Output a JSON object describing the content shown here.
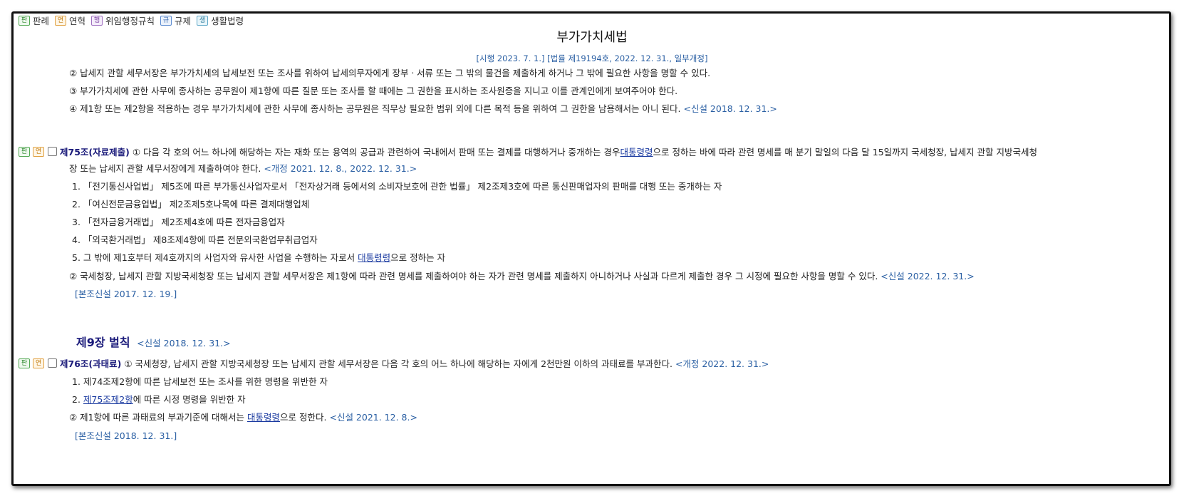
{
  "legend": [
    {
      "badge": "판",
      "label": "판례",
      "color": "green"
    },
    {
      "badge": "연",
      "label": "연혁",
      "color": "orange"
    },
    {
      "badge": "행",
      "label": "위임행정규칙",
      "color": "purple"
    },
    {
      "badge": "규",
      "label": "규제",
      "color": "blue"
    },
    {
      "badge": "생",
      "label": "생활법령",
      "color": "teal"
    }
  ],
  "doc": {
    "title": "부가가치세법",
    "subtitle": "[시행 2023. 7. 1.] [법률 제19194호, 2022. 12. 31., 일부개정]"
  },
  "art74": {
    "p2": "② 납세지 관할 세무서장은 부가가치세의 납세보전 또는 조사를 위하여 납세의무자에게 장부ㆍ서류 또는 그 밖의 물건을 제출하게 하거나 그 밖에 필요한 사항을 명할 수 있다.",
    "p3": "③ 부가가치세에 관한 사무에 종사하는 공무원이 제1항에 따른 질문 또는 조사를 할 때에는 그 권한을 표시하는 조사원증을 지니고 이를 관계인에게 보여주어야 한다.",
    "p4": "④ 제1항 또는 제2항을 적용하는 경우 부가가치세에 관한 사무에 종사하는 공무원은 직무상 필요한 범위 외에 다른 목적 등을 위하여 그 권한을 남용해서는 아니 된다.",
    "p4_amend": "<신설 2018. 12. 31.>"
  },
  "art75": {
    "badges": [
      "판",
      "연"
    ],
    "title": "제75조(자료제출)",
    "p1_a": "① 다음 각 호의 어느 하나에 해당하는 자는 재화 또는 용역의 공급과 관련하여 국내에서 판매 또는 결제를 대행하거나 중개하는 경우",
    "p1_link": "대통령령",
    "p1_b": "으로 정하는 바에 따라 관련 명세를 매 분기 말일의 다음 달 15일까지 국세청장, 납세지 관할 지방국세청",
    "p1_c": "장 또는 납세지 관할 세무서장에게 제출하여야 한다.",
    "p1_amend": "<개정 2021. 12. 8., 2022. 12. 31.>",
    "item1": "1. 「전기통신사업법」 제5조에 따른 부가통신사업자로서 「전자상거래 등에서의 소비자보호에 관한 법률」 제2조제3호에 따른 통신판매업자의 판매를 대행 또는 중개하는 자",
    "item2": "2. 「여신전문금융업법」 제2조제5호나목에 따른 결제대행업체",
    "item3": "3. 「전자금융거래법」 제2조제4호에 따른 전자금융업자",
    "item4": "4. 「외국환거래법」 제8조제4항에 따른 전문외국환업무취급업자",
    "item5_a": "5. 그 밖에 제1호부터 제4호까지의 사업자와 유사한 사업을 수행하는 자로서",
    "item5_link": "대통령령",
    "item5_b": "으로 정하는 자",
    "p2": "② 국세청장, 납세지 관할 지방국세청장 또는 납세지 관할 세무서장은 제1항에 따라 관련 명세를 제출하여야 하는 자가 관련 명세를 제출하지 아니하거나 사실과 다르게 제출한 경우 그 시정에 필요한 사항을 명할 수 있다.",
    "p2_amend": "<신설 2022. 12. 31.>",
    "note": "[본조신설 2017. 12. 19.]"
  },
  "chapter9": {
    "title": "제9장 벌칙",
    "amend": "<신설 2018. 12. 31.>"
  },
  "art76": {
    "badges": [
      "판",
      "연"
    ],
    "title": "제76조(과태료)",
    "p1": "① 국세청장, 납세지 관할 지방국세청장 또는 납세지 관할 세무서장은 다음 각 호의 어느 하나에 해당하는 자에게 2천만원 이하의 과태료를 부과한다.",
    "p1_amend": "<개정 2022. 12. 31.>",
    "item1": "1. 제74조제2항에 따른 납세보전 또는 조사를 위한 명령을 위반한 자",
    "item2_pre": "2. ",
    "item2_link": "제75조제2항",
    "item2_post": "에 따른 시정 명령을 위반한 자",
    "p2_a": "② 제1항에 따른 과태료의 부과기준에 대해서는",
    "p2_link": "대통령령",
    "p2_b": "으로 정한다.",
    "p2_amend": "<신설 2021. 12. 8.>",
    "note": "[본조신설 2018. 12. 31.]"
  }
}
